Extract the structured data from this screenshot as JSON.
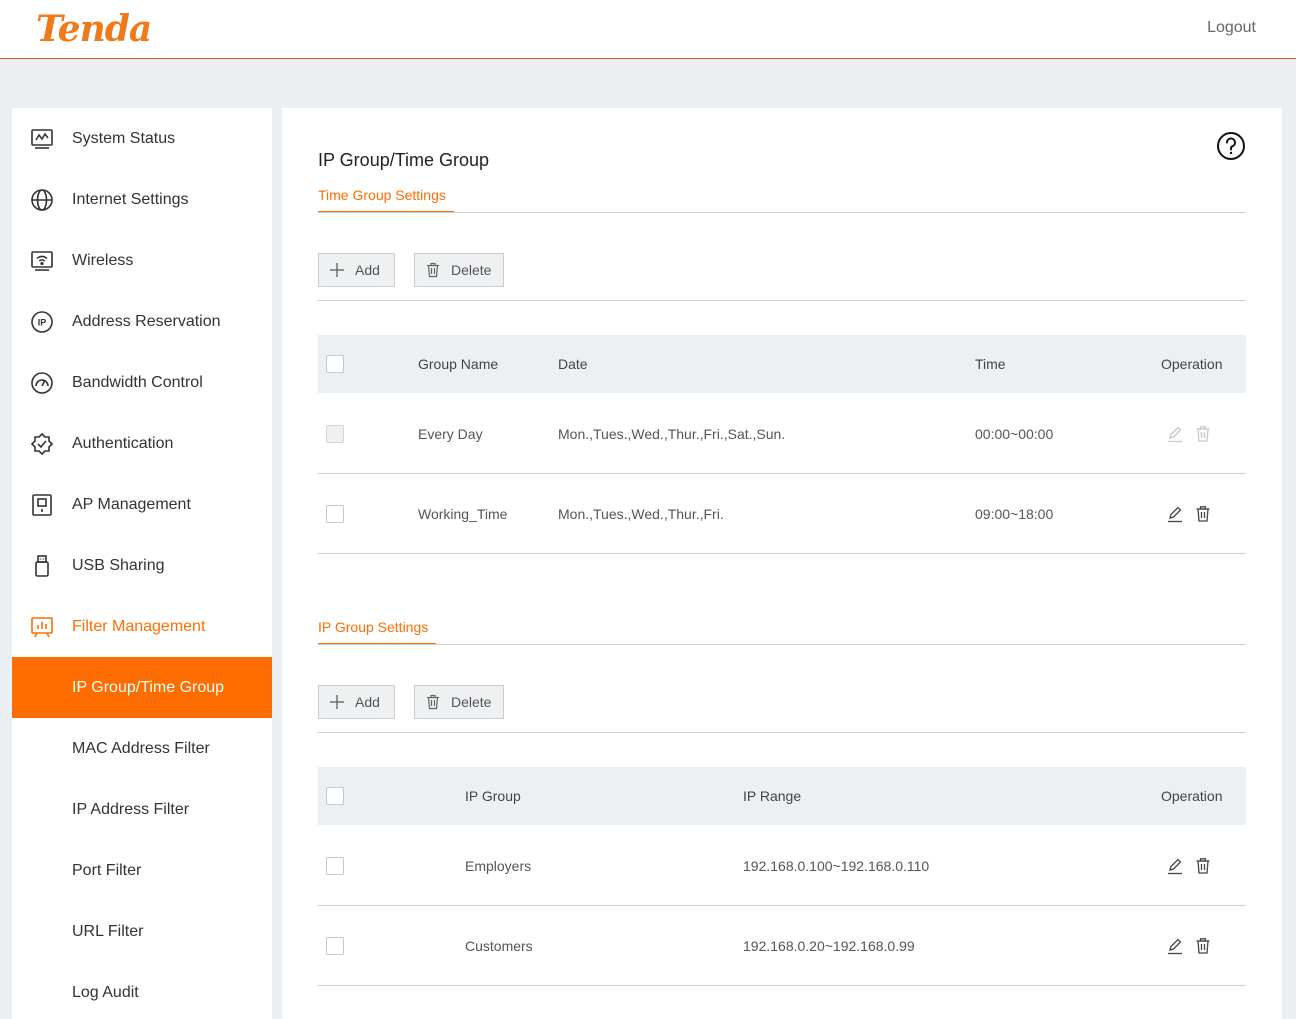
{
  "header": {
    "logo": "Tenda",
    "logout": "Logout"
  },
  "sidebar": {
    "items": [
      {
        "label": "System Status",
        "icon": "chart-monitor-icon"
      },
      {
        "label": "Internet Settings",
        "icon": "globe-icon"
      },
      {
        "label": "Wireless",
        "icon": "wifi-monitor-icon"
      },
      {
        "label": "Address Reservation",
        "icon": "ip-circle-icon"
      },
      {
        "label": "Bandwidth Control",
        "icon": "gauge-icon"
      },
      {
        "label": "Authentication",
        "icon": "shield-check-icon"
      },
      {
        "label": "AP Management",
        "icon": "ap-device-icon"
      },
      {
        "label": "USB Sharing",
        "icon": "usb-icon"
      },
      {
        "label": "Filter Management",
        "icon": "filter-chart-icon"
      }
    ],
    "subitems": [
      "IP Group/Time Group",
      "MAC Address Filter",
      "IP Address Filter",
      "Port Filter",
      "URL Filter",
      "Log Audit"
    ]
  },
  "main": {
    "title": "IP Group/Time Group",
    "time_group": {
      "tab": "Time Group Settings",
      "add": "Add",
      "delete": "Delete",
      "columns": [
        "Group Name",
        "Date",
        "Time",
        "Operation"
      ],
      "rows": [
        {
          "name": "Every Day",
          "date": "Mon.,Tues.,Wed.,Thur.,Fri.,Sat.,Sun.",
          "time": "00:00~00:00",
          "editable": false
        },
        {
          "name": "Working_Time",
          "date": "Mon.,Tues.,Wed.,Thur.,Fri.",
          "time": "09:00~18:00",
          "editable": true
        }
      ]
    },
    "ip_group": {
      "tab": "IP Group Settings",
      "add": "Add",
      "delete": "Delete",
      "columns": [
        "IP Group",
        "IP Range",
        "Operation"
      ],
      "rows": [
        {
          "name": "Employers",
          "range": "192.168.0.100~192.168.0.110"
        },
        {
          "name": "Customers",
          "range": "192.168.0.20~192.168.0.99"
        }
      ]
    }
  },
  "colors": {
    "accent": "#ff6d00",
    "header_line": "#e04a2f"
  }
}
